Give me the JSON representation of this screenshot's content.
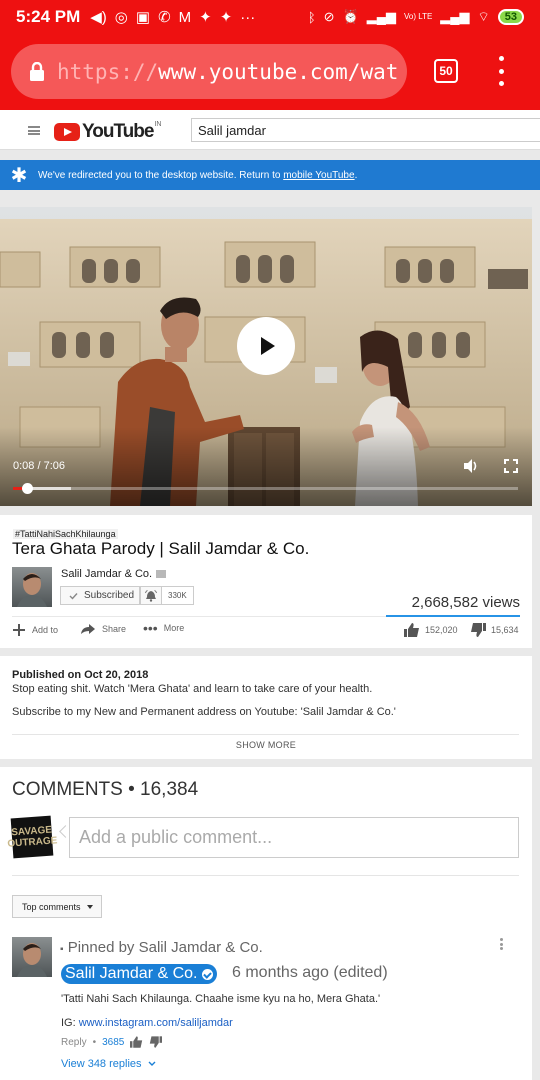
{
  "status_bar": {
    "time": "5:24 PM",
    "network_label": "Vo) LTE",
    "battery": "53"
  },
  "browser": {
    "url_scheme": "https://",
    "url_host": "www.youtube.com/wat",
    "tab_count": "50"
  },
  "yt_header": {
    "logo_text": "YouTube",
    "region": "IN",
    "search_value": "Salil jamdar"
  },
  "banner": {
    "text": "We've redirected you to the desktop website. Return to ",
    "link": "mobile YouTube",
    "suffix": "."
  },
  "player": {
    "time": "0:08 / 7:06",
    "progress": 0.019,
    "buffered": 0.115
  },
  "video": {
    "hashtag": "#TattiNahiSachKhilaunga",
    "title": "Tera Ghata Parody | Salil Jamdar & Co.",
    "channel": "Salil Jamdar & Co.",
    "subscribe_label": "Subscribed",
    "subscriber_count": "330K",
    "views": "2,668,582 views",
    "add_to": "Add to",
    "share": "Share",
    "more": "More",
    "likes": "152,020",
    "dislikes": "15,634"
  },
  "description": {
    "published": "Published on Oct 20, 2018",
    "line1": "Stop eating shit. Watch 'Mera Ghata' and learn to take care of your health.",
    "line2": "Subscribe to my New and Permanent address on Youtube: 'Salil Jamdar & Co.'",
    "show_more": "SHOW MORE"
  },
  "comments": {
    "header": "COMMENTS • 16,384",
    "my_avatar_line1": "SAVAGE",
    "my_avatar_line2": "OUTRAGE",
    "placeholder": "Add a public comment...",
    "sort_label": "Top comments",
    "pinned": {
      "pinned_label": "Pinned by Salil Jamdar & Co.",
      "author": "Salil Jamdar & Co.",
      "time": "6 months ago (edited)",
      "text": "'Tatti Nahi Sach Khilaunga. Chaahe isme kyu na ho, Mera Ghata.'",
      "ig_prefix": "IG: ",
      "ig_link": "www.instagram.com/saliljamdar",
      "reply_label": "Reply",
      "like_count": "3685",
      "view_replies": "View 348 replies"
    }
  },
  "colors": {
    "chrome_red": "#ee1111",
    "banner_blue": "#1f7ad1",
    "yt_red": "#e62117",
    "link_blue": "#1a7fd6"
  }
}
